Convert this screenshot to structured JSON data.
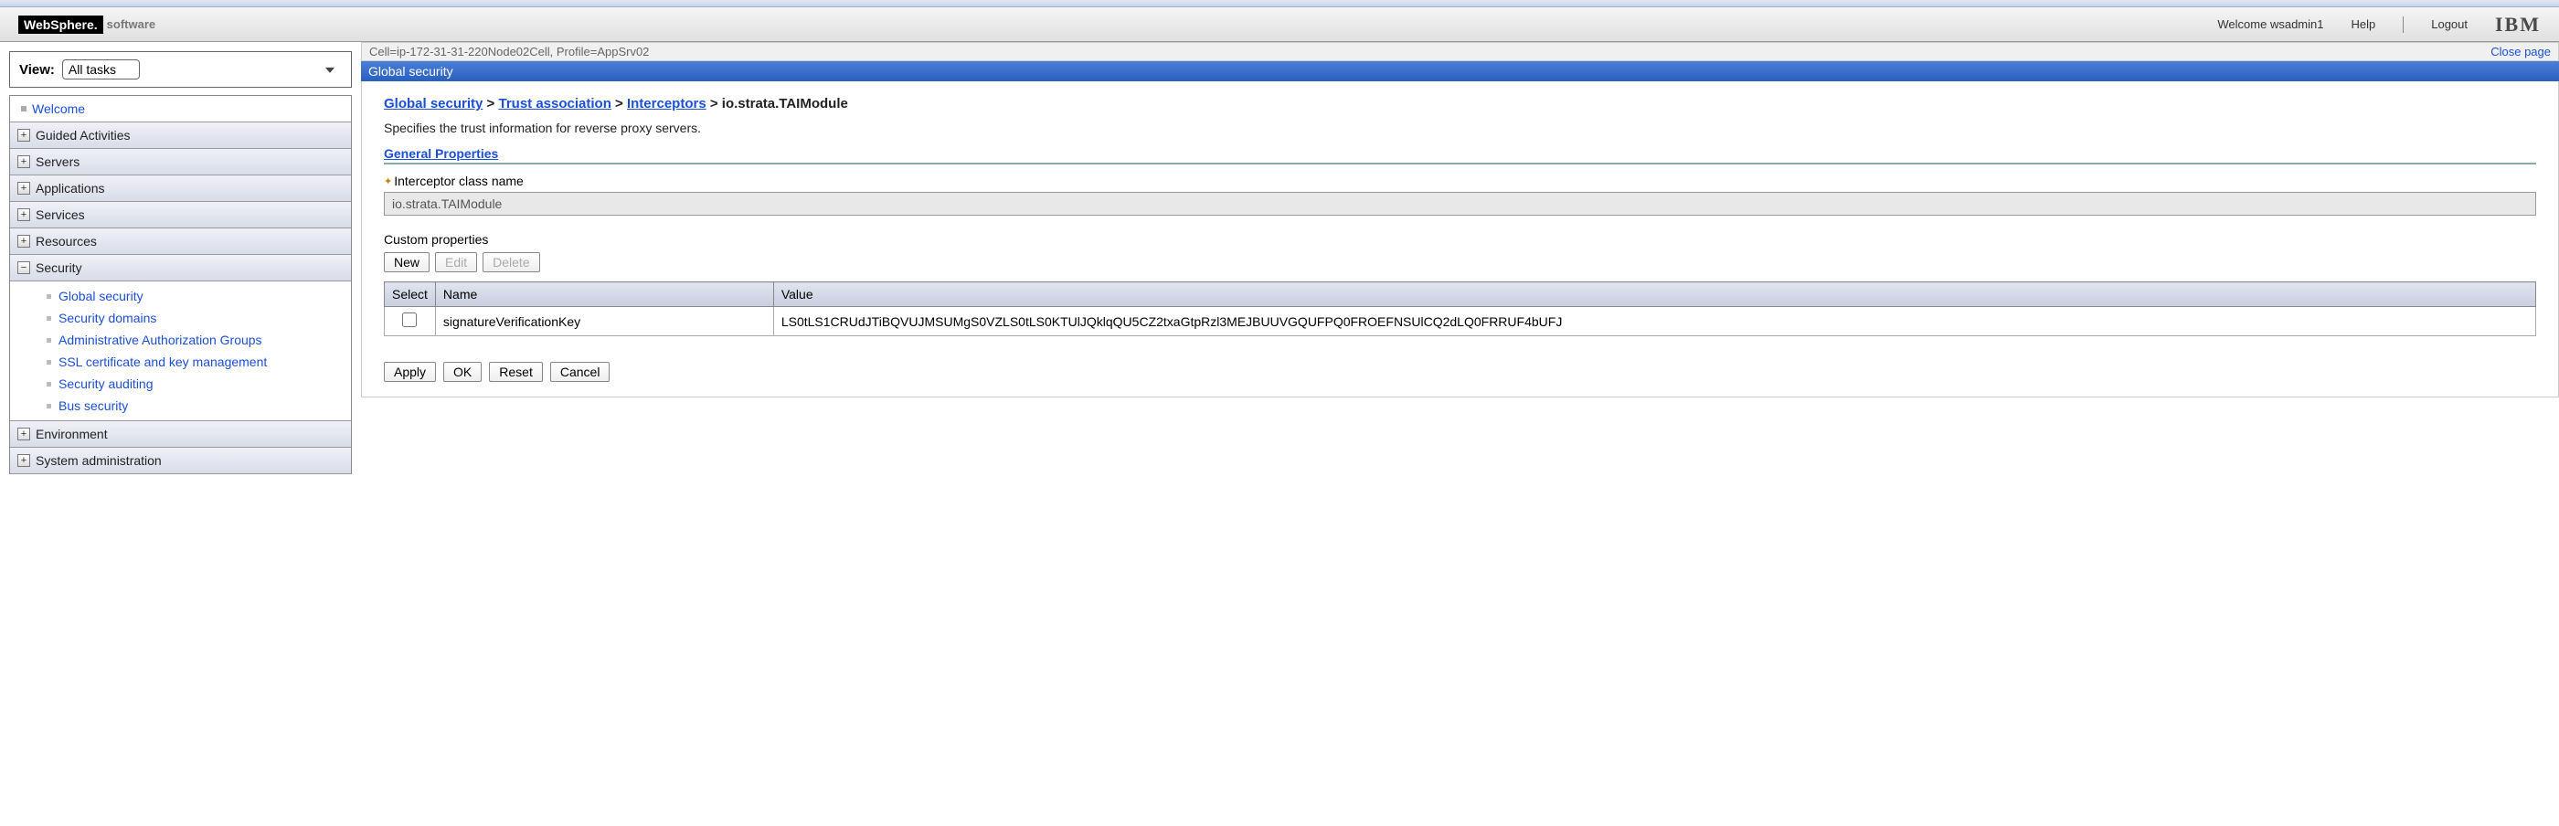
{
  "header": {
    "logo_main": "WebSphere.",
    "logo_sub": "software",
    "welcome": "Welcome wsadmin1",
    "help": "Help",
    "logout": "Logout",
    "brand": "IBM"
  },
  "sidebar": {
    "view_label": "View:",
    "view_value": "All tasks",
    "welcome_label": "Welcome",
    "groups": [
      {
        "label": "Guided Activities",
        "expanded": false
      },
      {
        "label": "Servers",
        "expanded": false
      },
      {
        "label": "Applications",
        "expanded": false
      },
      {
        "label": "Services",
        "expanded": false
      },
      {
        "label": "Resources",
        "expanded": false
      },
      {
        "label": "Security",
        "expanded": true,
        "items": [
          {
            "label": "Global security"
          },
          {
            "label": "Security domains"
          },
          {
            "label": "Administrative Authorization Groups"
          },
          {
            "label": "SSL certificate and key management"
          },
          {
            "label": "Security auditing"
          },
          {
            "label": "Bus security"
          }
        ]
      },
      {
        "label": "Environment",
        "expanded": false
      },
      {
        "label": "System administration",
        "expanded": false
      }
    ]
  },
  "main": {
    "cell_info": "Cell=ip-172-31-31-220Node02Cell, Profile=AppSrv02",
    "close_page": "Close page",
    "title": "Global security",
    "breadcrumb": {
      "a": "Global security",
      "b": "Trust association",
      "c": "Interceptors",
      "last": "io.strata.TAIModule"
    },
    "description": "Specifies the trust information for reverse proxy servers.",
    "section": "General Properties",
    "field_label": "Interceptor class name",
    "field_value": "io.strata.TAIModule",
    "custom_props": "Custom properties",
    "buttons": {
      "new": "New",
      "edit": "Edit",
      "delete": "Delete"
    },
    "table": {
      "headers": {
        "select": "Select",
        "name": "Name",
        "value": "Value"
      },
      "rows": [
        {
          "name": "signatureVerificationKey",
          "value": "LS0tLS1CRUdJTiBQVUJMSUMgS0VZLS0tLS0KTUlJQklqQU5CZ2txaGtpRzl3MEJBUUVGQUFPQ0FROEFNSUlCQ2dLQ0FRRUF4bUFJ"
        }
      ]
    },
    "actions": {
      "apply": "Apply",
      "ok": "OK",
      "reset": "Reset",
      "cancel": "Cancel"
    }
  }
}
